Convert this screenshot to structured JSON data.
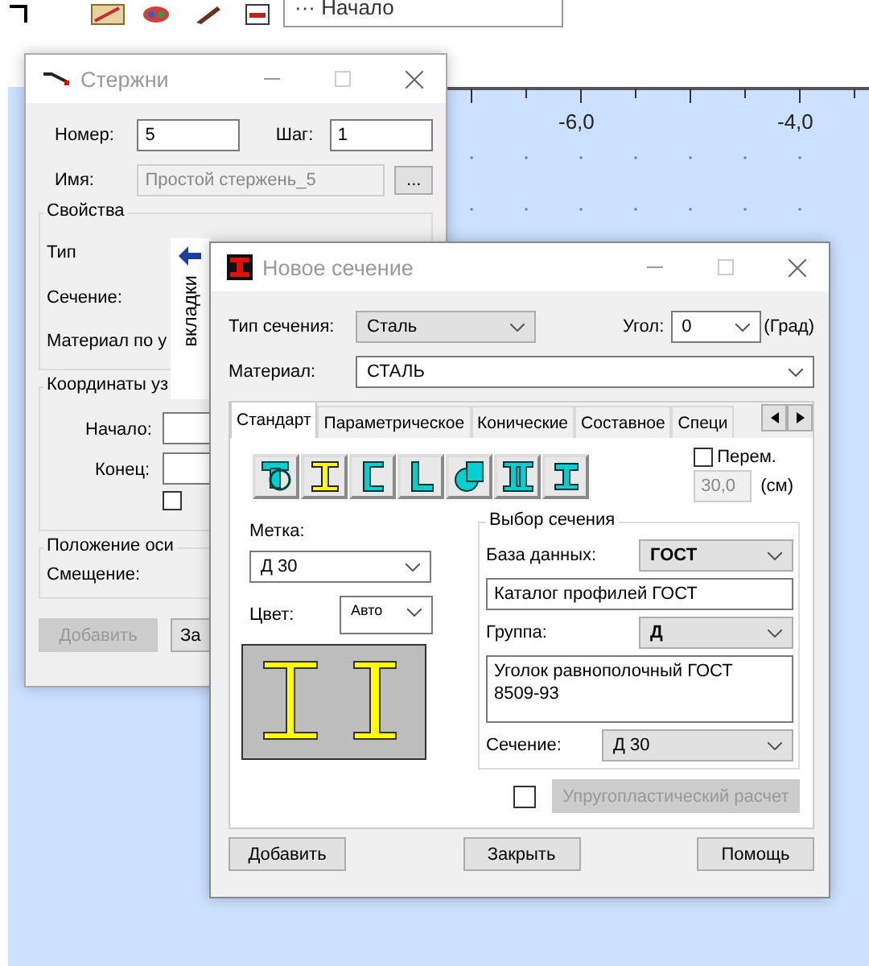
{
  "toolbar": {
    "dropdown_value": "··· Начало"
  },
  "ruler": {
    "labels": [
      "-6,0",
      "-4,0"
    ]
  },
  "bars_window": {
    "title": "Стержни",
    "number_label": "Номер:",
    "number": "5",
    "step_label": "Шаг:",
    "step": "1",
    "name_label": "Имя:",
    "name": "Простой стержень_5",
    "browse": "...",
    "properties": {
      "title": "Свойства",
      "type_label": "Тип",
      "section_label": "Сечение:",
      "material_label": "Материал по у"
    },
    "coords": {
      "title": "Координаты уз",
      "start_label": "Начало:",
      "end_label": "Конец:",
      "checked": false
    },
    "axis": {
      "title": "Положение оси",
      "offset_label": "Смещение:"
    },
    "buttons": [
      {
        "label": "Добавить",
        "disabled": true
      },
      {
        "label": "За",
        "disabled": false
      }
    ]
  },
  "tooltip": {
    "text": "вкладки"
  },
  "section_window": {
    "title": "Новое сечение",
    "type_label": "Тип сечения:",
    "type": "Сталь",
    "angle_label": "Угол:",
    "angle": "0",
    "angle_unit": "(Град)",
    "material_label": "Материал:",
    "material": "СТАЛЬ",
    "tabs": [
      {
        "label": "Стандарт",
        "selected": true
      },
      {
        "label": "Параметрическое",
        "selected": false
      },
      {
        "label": "Конические",
        "selected": false
      },
      {
        "label": "Составное",
        "selected": false
      },
      {
        "label": "Специ",
        "selected": false
      }
    ],
    "shapes": [
      {
        "kind": "composite"
      },
      {
        "kind": "ibeam"
      },
      {
        "kind": "channel"
      },
      {
        "kind": "angle"
      },
      {
        "kind": "round"
      },
      {
        "kind": "double"
      },
      {
        "kind": "tee"
      }
    ],
    "variable": {
      "label": "Перем.",
      "checked": false,
      "value": "30,0",
      "unit": "(см)"
    },
    "mark_label": "Метка:",
    "mark": "Д 30",
    "color_label": "Цвет:",
    "color_value": "Авто",
    "selection": {
      "title": "Выбор сечения",
      "db_label": "База данных:",
      "db": "ГОСТ",
      "catalog": "Каталог профилей ГОСТ",
      "group_label": "Группа:",
      "group": "Д",
      "description": "Уголок равнополочный ГОСТ 8509-93",
      "section_label": "Сечение:",
      "section": "Д 30"
    },
    "elastoplastic": {
      "checked": false,
      "label": "Упругопластический  расчет",
      "disabled": true
    },
    "buttons": [
      "Добавить",
      "Закрыть",
      "Помощь"
    ]
  }
}
